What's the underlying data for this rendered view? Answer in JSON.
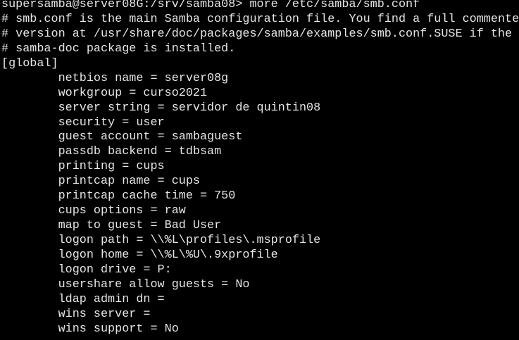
{
  "terminal": {
    "lines": [
      "supersamba@server08G:/srv/samba08> more /etc/samba/smb.conf",
      "# smb.conf is the main Samba configuration file. You find a full commented",
      "# version at /usr/share/doc/packages/samba/examples/smb.conf.SUSE if the",
      "# samba-doc package is installed.",
      "[global]",
      "        netbios name = server08g",
      "        workgroup = curso2021",
      "        server string = servidor de quintin08",
      "        security = user",
      "        guest account = sambaguest",
      "        passdb backend = tdbsam",
      "        printing = cups",
      "        printcap name = cups",
      "        printcap cache time = 750",
      "        cups options = raw",
      "        map to guest = Bad User",
      "        logon path = \\\\%L\\profiles\\.msprofile",
      "        logon home = \\\\%L\\%U\\.9xprofile",
      "        logon drive = P:",
      "        usershare allow guests = No",
      "        ldap admin dn =",
      "        wins server =",
      "        wins support = No"
    ]
  },
  "colors": {
    "background": "#000000",
    "foreground": "#e6e6e6"
  }
}
